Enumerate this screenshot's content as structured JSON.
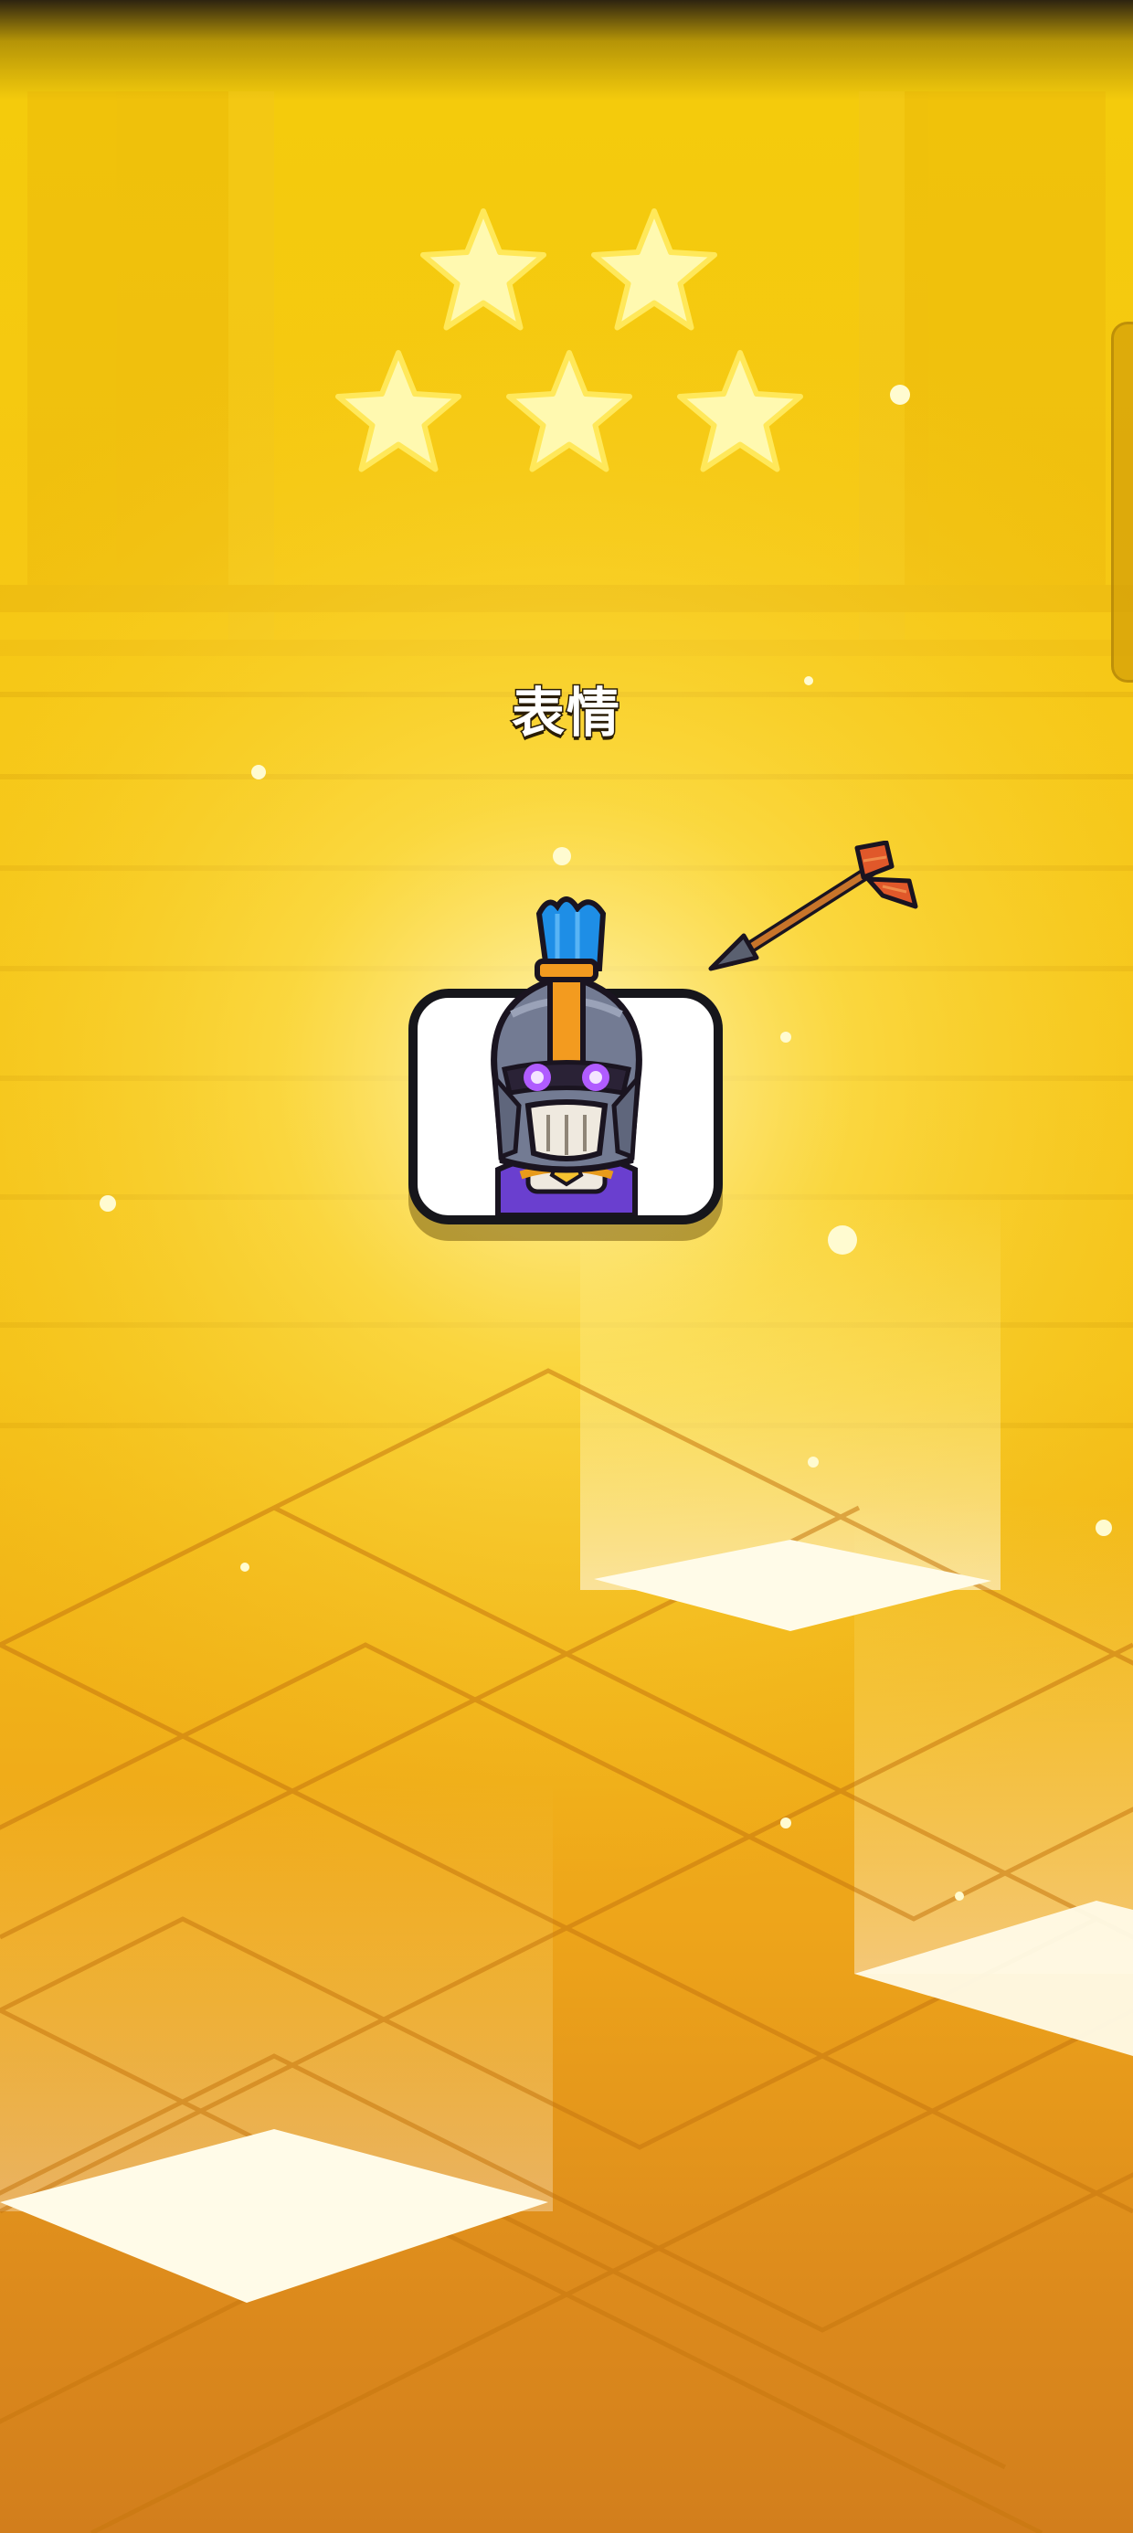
{
  "reward": {
    "title": "表情",
    "rarity_stars": 5,
    "item_type": "emote",
    "emote_character": "skeleton-knight-with-arrow"
  },
  "icons": {
    "stars": [
      "star-icon",
      "star-icon",
      "star-icon",
      "star-icon",
      "star-icon"
    ],
    "arrow": "arrow-icon",
    "character": "skeleton-knight-icon"
  },
  "colors": {
    "background": "#f4c30f",
    "star_fill": "#fff9b0",
    "title_text": "#ffffff",
    "title_outline": "#2a1d05",
    "card_border": "#16161b",
    "card_fill": "#ffffff",
    "plume": "#1e8ee6",
    "helmet": "#737b93",
    "eye_glow": "#b05cff"
  }
}
